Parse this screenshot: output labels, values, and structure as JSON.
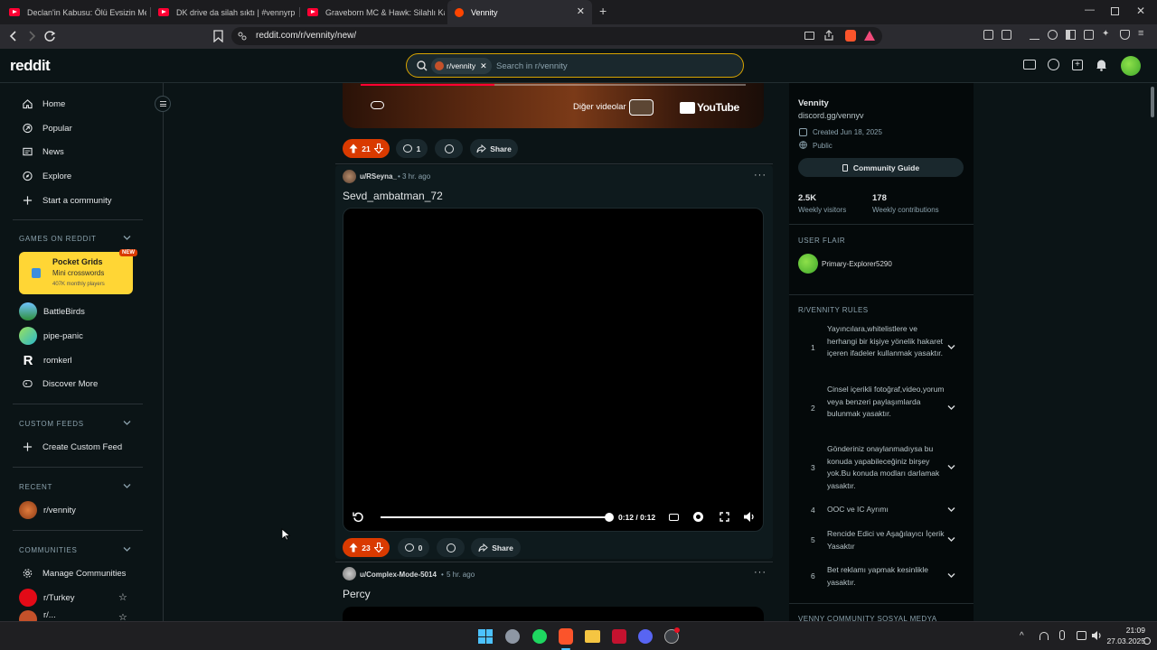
{
  "browser": {
    "tabs": [
      {
        "title": "Declan'in Kabusu: Ölü Evsizin Mezarı"
      },
      {
        "title": "DK drive da silah sıktı | #vennyrp #ve"
      },
      {
        "title": "Graveborn MC & Hawk: Silahlı Kavga"
      },
      {
        "title": "Vennity"
      }
    ],
    "url": "reddit.com/r/vennity/new/"
  },
  "header": {
    "logo": "reddit",
    "search_chip": "r/vennity",
    "search_placeholder": "Search in r/vennity"
  },
  "sidebar": {
    "nav": [
      {
        "label": "Home",
        "icon": "home-icon"
      },
      {
        "label": "Popular",
        "icon": "popular-icon"
      },
      {
        "label": "News",
        "icon": "news-icon"
      },
      {
        "label": "Explore",
        "icon": "explore-icon"
      },
      {
        "label": "Start a community",
        "icon": "plus-icon"
      }
    ],
    "games_title": "GAMES ON REDDIT",
    "featured_game": {
      "name": "Pocket Grids",
      "sub": "Mini crosswords",
      "players": "407K monthly players",
      "badge": "NEW"
    },
    "games": [
      {
        "label": "BattleBirds"
      },
      {
        "label": "pipe-panic"
      },
      {
        "label": "romkerl"
      },
      {
        "label": "Discover More"
      }
    ],
    "custom_title": "CUSTOM FEEDS",
    "create_feed": "Create Custom Feed",
    "recent_title": "RECENT",
    "recent": [
      {
        "label": "r/vennity"
      }
    ],
    "communities_title": "COMMUNITIES",
    "manage": "Manage Communities",
    "communities": [
      {
        "label": "r/Turkey"
      },
      {
        "label": "r/..."
      }
    ]
  },
  "top_embed": {
    "more_videos": "Diğer videolar",
    "youtube": "YouTube"
  },
  "posts": [
    {
      "votes": "21",
      "comments": "1",
      "share": "Share"
    },
    {
      "author": "u/RSeyna_",
      "time": "3 hr. ago",
      "title": "Sevd_ambatman_72",
      "video_time": "0:12 / 0:12",
      "progress": 1.0,
      "votes": "23",
      "comments": "0",
      "share": "Share"
    },
    {
      "author": "u/Complex-Mode-5014",
      "time": "5 hr. ago",
      "title": "Percy"
    }
  ],
  "rail": {
    "name": "Vennity",
    "link": "discord.gg/vennyv",
    "created": "Created Jun 18, 2025",
    "visibility": "Public",
    "guide": "Community Guide",
    "visitors": "2.5K",
    "visitors_label": "Weekly visitors",
    "contributions": "178",
    "contributions_label": "Weekly contributions",
    "flair_title": "USER FLAIR",
    "flair_user": "Primary-Explorer5290",
    "rules_title": "R/VENNITY RULES",
    "rules": [
      {
        "n": "1",
        "text": "Yayıncılara,whitelistlere ve herhangi bir kişiye yönelik hakaret içeren ifadeler kullanmak yasaktır."
      },
      {
        "n": "2",
        "text": "Cinsel içerikli fotoğraf,video,yorum veya benzeri paylaşımlarda bulunmak yasaktır."
      },
      {
        "n": "3",
        "text": "Gönderiniz onaylanmadıysa bu konuda yapabileceğiniz birşey yok.Bu konuda modları darlamak yasaktır."
      },
      {
        "n": "4",
        "text": "OOC ve IC Ayrımı"
      },
      {
        "n": "5",
        "text": "Rencide Edici ve Aşağılayıcı İçerik Yasaktır"
      },
      {
        "n": "6",
        "text": "Bet reklamı yapmak kesinlikle yasaktır."
      }
    ],
    "social_title": "VENNY COMMUNITY SOSYAL MEDYA"
  },
  "taskbar": {
    "time": "21:09",
    "date": "27.03.2025"
  },
  "colors": {
    "accent": "#d93a00",
    "bg": "#0b1416",
    "search_border": "#d8a400"
  }
}
